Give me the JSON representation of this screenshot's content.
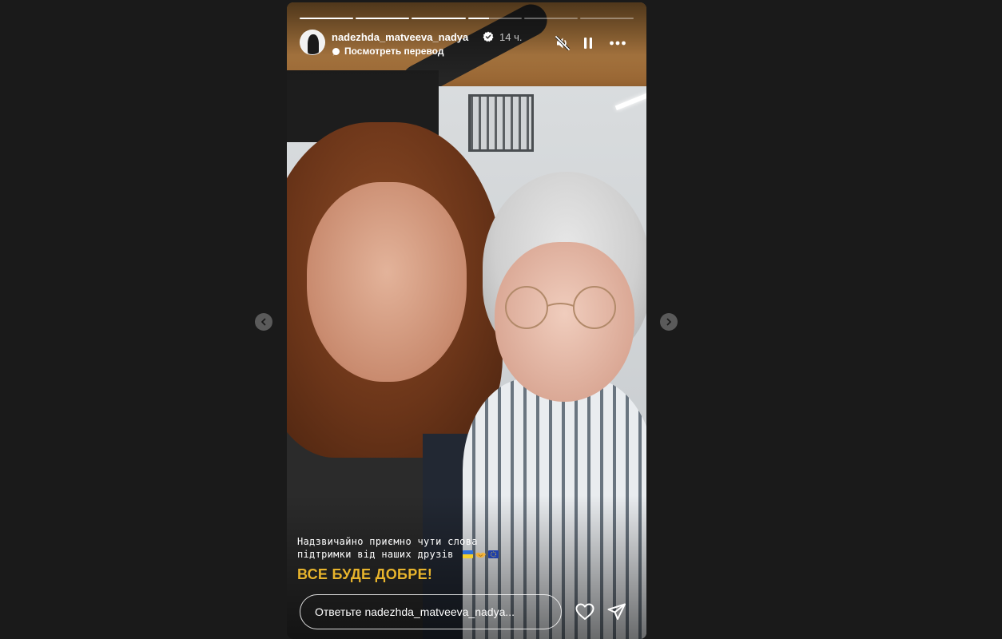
{
  "story": {
    "username": "nadezhda_matveeva_nadya",
    "time_ago": "14 ч.",
    "translate_label": "Посмотреть перевод",
    "progress_segments": [
      1,
      1,
      1,
      0.4,
      0,
      0
    ],
    "icons": {
      "verified": "verified-badge-icon",
      "mute": "speaker-muted-icon",
      "pause": "pause-icon",
      "more": "more-options-icon",
      "translate": "translate-dot-icon"
    }
  },
  "caption": {
    "line1": "Надзвичайно приємно чути слова",
    "line2": "підтримки від наших друзів",
    "headline": "ВСЕ БУДЕ ДОБРЕ!",
    "emoji": [
      "ukraine-flag-emoji",
      "handshake-emoji",
      "eu-flag-emoji"
    ]
  },
  "reply": {
    "placeholder": "Ответьте nadezhda_matveeva_nadya...",
    "icons": {
      "like": "heart-icon",
      "send": "send-icon"
    }
  },
  "navigation": {
    "prev": "chevron-left-icon",
    "next": "chevron-right-icon"
  },
  "colors": {
    "page_background": "#1a1a1a",
    "headline": "#e8b42c",
    "nav_button": "#5a5a5a"
  }
}
